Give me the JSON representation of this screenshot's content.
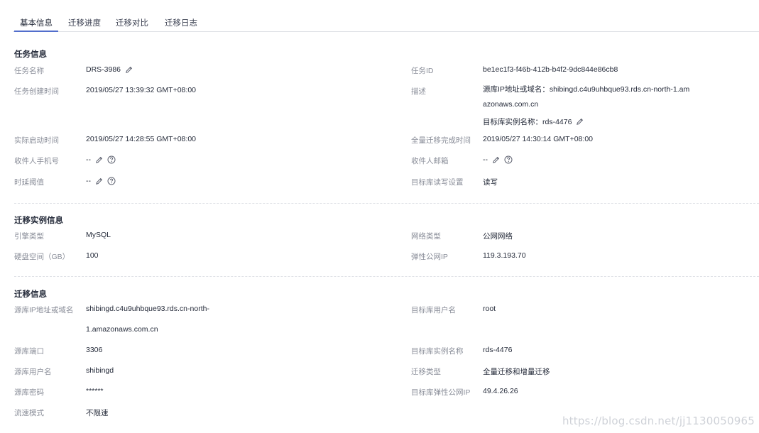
{
  "tabs": [
    {
      "label": "基本信息",
      "active": true
    },
    {
      "label": "迁移进度",
      "active": false
    },
    {
      "label": "迁移对比",
      "active": false
    },
    {
      "label": "迁移日志",
      "active": false
    }
  ],
  "task_info": {
    "title": "任务信息",
    "task_name_label": "任务名称",
    "task_name": "DRS-3986",
    "task_id_label": "任务ID",
    "task_id": "be1ec1f3-f46b-412b-b4f2-9dc844e86cb8",
    "created_label": "任务创建时间",
    "created": "2019/05/27 13:39:32 GMT+08:00",
    "desc_label": "描述",
    "desc_line1": "源库IP地址或域名：shibingd.c4u9uhbque93.rds.cn-north-1.am",
    "desc_line2": "azonaws.com.cn",
    "desc_line3": "目标库实例名称：rds-4476",
    "started_label": "实际启动时间",
    "started": "2019/05/27 14:28:55 GMT+08:00",
    "full_done_label": "全量迁移完成时间",
    "full_done": "2019/05/27 14:30:14 GMT+08:00",
    "phone_label": "收件人手机号",
    "phone": "--",
    "email_label": "收件人邮箱",
    "email": "--",
    "delay_label": "时延阈值",
    "delay": "--",
    "rw_label": "目标库读写设置",
    "rw": "读写"
  },
  "instance_info": {
    "title": "迁移实例信息",
    "engine_label": "引擎类型",
    "engine": "MySQL",
    "network_label": "网络类型",
    "network": "公网网络",
    "disk_label": "硬盘空间（GB）",
    "disk": "100",
    "eip_label": "弹性公网IP",
    "eip": "119.3.193.70"
  },
  "migration_info": {
    "title": "迁移信息",
    "src_host_label": "源库IP地址或域名",
    "src_host_line1": "shibingd.c4u9uhbque93.rds.cn-north-",
    "src_host_line2": "1.amazonaws.com.cn",
    "dst_user_label": "目标库用户名",
    "dst_user": "root",
    "src_port_label": "源库端口",
    "src_port": "3306",
    "dst_instance_label": "目标库实例名称",
    "dst_instance": "rds-4476",
    "src_user_label": "源库用户名",
    "src_user": "shibingd",
    "mig_type_label": "迁移类型",
    "mig_type": "全量迁移和增量迁移",
    "src_pwd_label": "源库密码",
    "src_pwd": "******",
    "dst_eip_label": "目标库弹性公网IP",
    "dst_eip": "49.4.26.26",
    "speed_label": "流速模式",
    "speed": "不限速"
  },
  "watermark": "https://blog.csdn.net/jj1130050965",
  "colors": {
    "accent": "#526ecc",
    "label": "#8a8e99",
    "text": "#252b3a"
  },
  "icons": {
    "edit": "pencil-icon",
    "help": "question-circle-icon"
  }
}
